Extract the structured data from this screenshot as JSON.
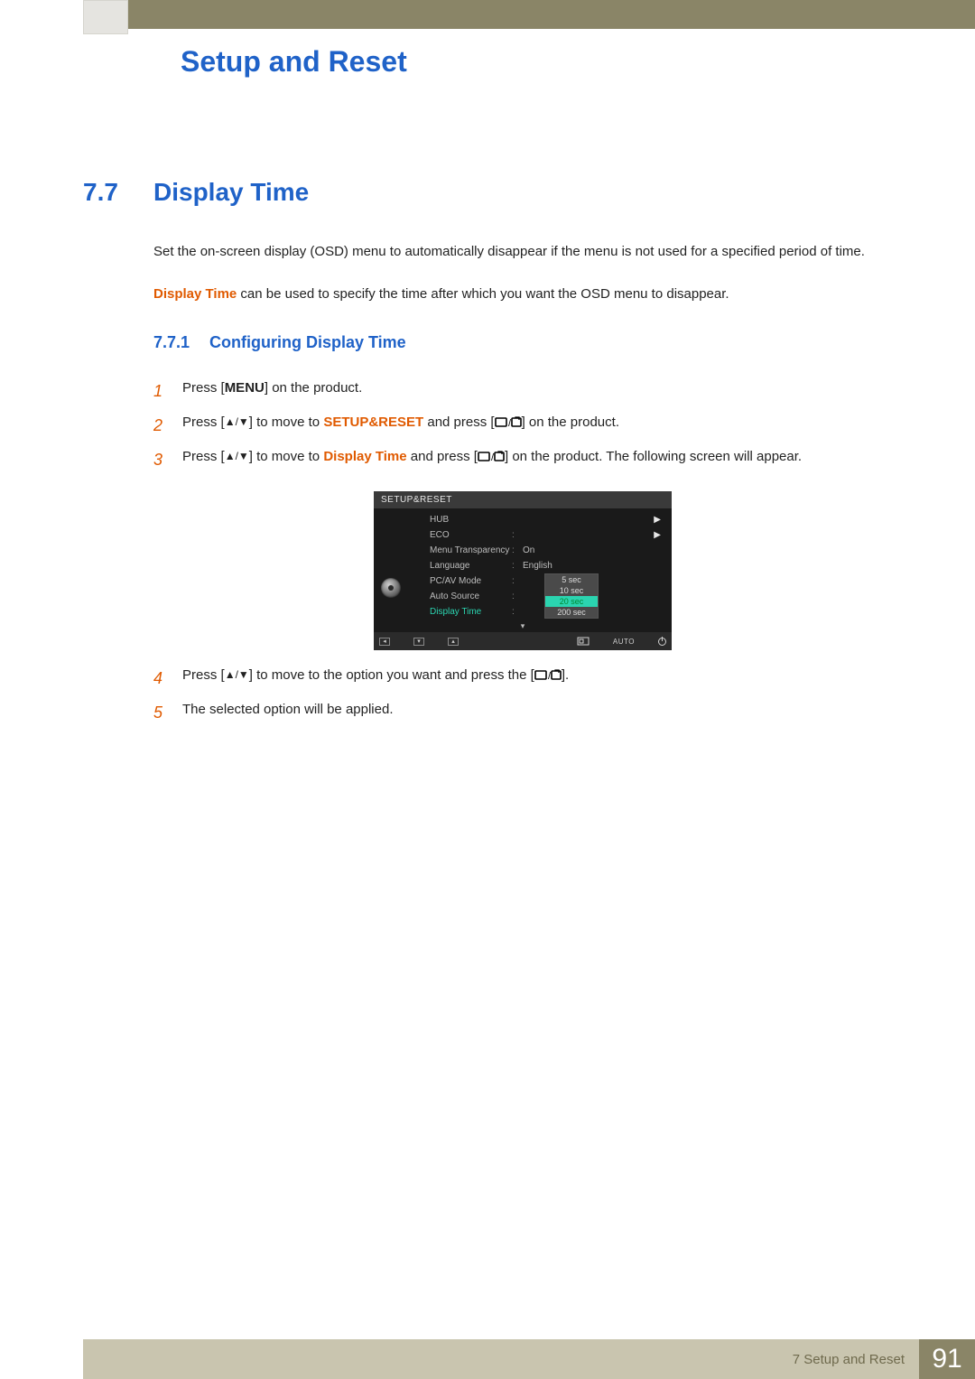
{
  "chapter": {
    "title": "Setup and Reset"
  },
  "section": {
    "num": "7.7",
    "title": "Display Time"
  },
  "intro1": "Set the on-screen display (OSD) menu to automatically disappear if the menu is not used for a specified period of time.",
  "intro2_label": "Display Time",
  "intro2_rest": " can be used to specify the time after which you want the OSD menu to disappear.",
  "subsection": {
    "num": "7.7.1",
    "title": "Configuring Display Time"
  },
  "menu_key": "MENU",
  "steps": {
    "s1": {
      "num": "1",
      "pre": "Press [",
      "post": "] on the product."
    },
    "s2": {
      "num": "2",
      "pre": "Press [",
      "mid1": "] to move to ",
      "target": "SETUP&RESET",
      "mid2": " and press [",
      "post": "] on the product."
    },
    "s3": {
      "num": "3",
      "pre": "Press [",
      "mid1": "] to move to ",
      "target": "Display Time",
      "mid2": " and press [",
      "post": "] on the product. The following screen will appear."
    },
    "s4": {
      "num": "4",
      "pre": "Press [",
      "mid": "] to move to the option you want and press the [",
      "post": "]."
    },
    "s5": {
      "num": "5",
      "text": "The selected option will be applied."
    }
  },
  "osd": {
    "title": "SETUP&RESET",
    "rows": [
      {
        "label": "HUB",
        "value": "",
        "arrow": true
      },
      {
        "label": "ECO",
        "value": "",
        "colon": ":",
        "arrow": true
      },
      {
        "label": "Menu Transparency",
        "value": "On",
        "colon": ":"
      },
      {
        "label": "Language",
        "value": "English",
        "colon": ":"
      },
      {
        "label": "PC/AV Mode",
        "value": "",
        "colon": ":"
      },
      {
        "label": "Auto Source",
        "value": "",
        "colon": ":"
      },
      {
        "label": "Display Time",
        "value": "",
        "colon": ":",
        "active": true
      }
    ],
    "dropdown": [
      "5 sec",
      "10 sec",
      "20 sec",
      "200 sec"
    ],
    "dropdown_selected_index": 2,
    "bottom_auto": "AUTO"
  },
  "footer": {
    "chapter": "7 Setup and Reset",
    "page": "91"
  }
}
